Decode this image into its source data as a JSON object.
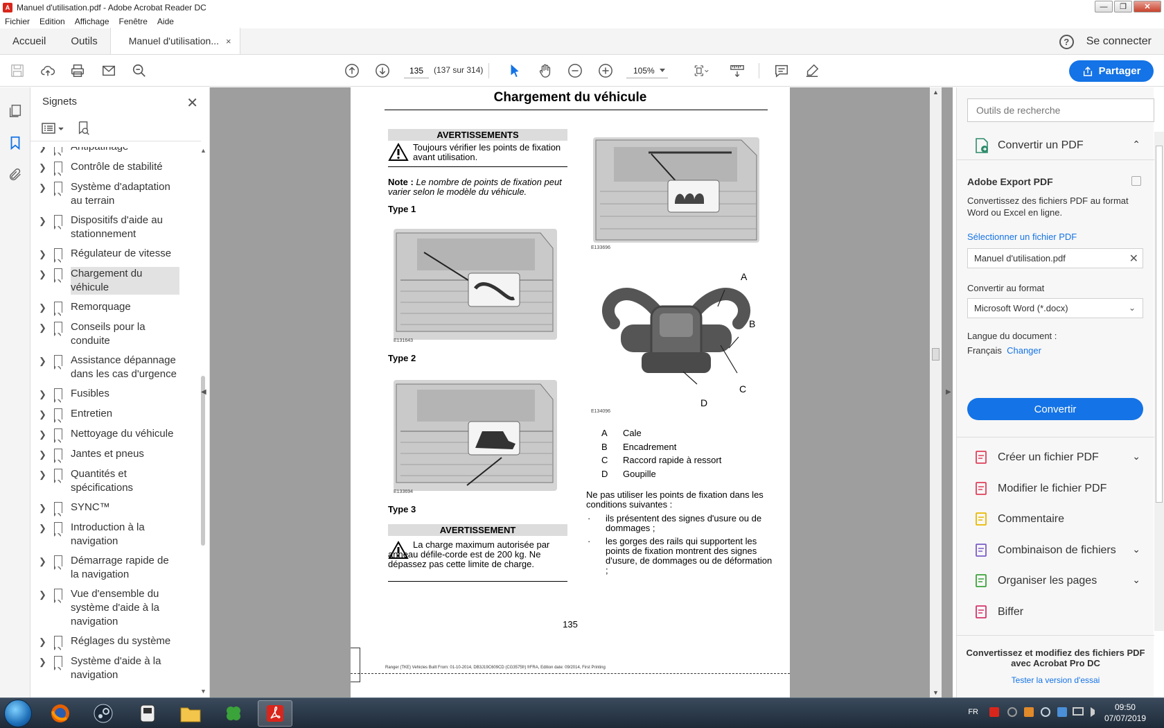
{
  "window": {
    "title": "Manuel d'utilisation.pdf - Adobe Acrobat Reader DC",
    "controls": [
      "—",
      "❐",
      "✕"
    ]
  },
  "menu": [
    "Fichier",
    "Edition",
    "Affichage",
    "Fenêtre",
    "Aide"
  ],
  "tabs": {
    "home": "Accueil",
    "tools": "Outils",
    "document": "Manuel d'utilisation...",
    "close": "×",
    "help": "?",
    "signin": "Se connecter"
  },
  "toolbar": {
    "page_number": "135",
    "page_count": "(137 sur 314)",
    "zoom": "105%",
    "share": "Partager"
  },
  "bookmarks": {
    "title": "Signets",
    "close": "✕",
    "items": [
      {
        "label": "Antipatinage",
        "selected": false
      },
      {
        "label": "Contrôle de stabilité",
        "selected": false
      },
      {
        "label": "Système d'adaptation au terrain",
        "selected": false
      },
      {
        "label": "Dispositifs d'aide au stationnement",
        "selected": false
      },
      {
        "label": "Régulateur de vitesse",
        "selected": false
      },
      {
        "label": "Chargement du véhicule",
        "selected": true
      },
      {
        "label": "Remorquage",
        "selected": false
      },
      {
        "label": "Conseils pour la conduite",
        "selected": false
      },
      {
        "label": "Assistance dépannage dans les cas d'urgence",
        "selected": false
      },
      {
        "label": "Fusibles",
        "selected": false
      },
      {
        "label": "Entretien",
        "selected": false
      },
      {
        "label": "Nettoyage du véhicule",
        "selected": false
      },
      {
        "label": "Jantes et pneus",
        "selected": false
      },
      {
        "label": "Quantités et spécifications",
        "selected": false
      },
      {
        "label": "SYNC™",
        "selected": false
      },
      {
        "label": "Introduction à la navigation",
        "selected": false
      },
      {
        "label": "Démarrage rapide de la navigation",
        "selected": false
      },
      {
        "label": "Vue d'ensemble du système d'aide à la navigation",
        "selected": false
      },
      {
        "label": "Réglages du système",
        "selected": false
      },
      {
        "label": "Système d'aide à la navigation",
        "selected": false
      }
    ]
  },
  "page": {
    "title": "Chargement du véhicule",
    "warnings_header": "AVERTISSEMENTS",
    "warning1": "Toujours vérifier les points de fixation avant utilisation.",
    "note_label": "Note :",
    "note_text": "Le nombre de points de fixation peut varier selon le modèle du véhicule.",
    "type1": "Type 1",
    "type2": "Type 2",
    "type3": "Type 3",
    "img1_code": "E131643",
    "img2_code": "E133694",
    "img3_code": "E133696",
    "img4_code": "E134096",
    "warning_header2": "AVERTISSEMENT",
    "warning2": "La charge maximum autorisée par anneau défile-corde est de 200 kg. Ne dépassez pas cette limite de charge.",
    "callouts": [
      {
        "letter": "A",
        "label": "Cale"
      },
      {
        "letter": "B",
        "label": "Encadrement"
      },
      {
        "letter": "C",
        "label": "Raccord rapide à ressort"
      },
      {
        "letter": "D",
        "label": "Goupille"
      }
    ],
    "diagram_letters": [
      "A",
      "B",
      "C",
      "D"
    ],
    "conditions_intro": "Ne pas utiliser les points de fixation dans les conditions suivantes :",
    "bullets": [
      "ils présentent des signes d'usure ou de dommages ;",
      "les gorges des rails qui supportent les points de fixation montrent des signes d'usure, de dommages ou de déformation ;"
    ],
    "page_num": "135",
    "footer": "Ranger (TKE) Vehicles Built From: 01-10-2014, DB3J19C609CD (CG3575fr) frFRA, Edition date: 09/2014, First Printing"
  },
  "right_panel": {
    "search_placeholder": "Outils de recherche",
    "convert_pdf": "Convertir un PDF",
    "export_title": "Adobe Export PDF",
    "export_desc": "Convertissez des fichiers PDF au format Word ou Excel en ligne.",
    "select_file": "Sélectionner un fichier PDF",
    "file_name": "Manuel d'utilisation.pdf",
    "format_label": "Convertir au format",
    "format_value": "Microsoft Word (*.docx)",
    "lang_label": "Langue du document :",
    "lang_value": "Français",
    "lang_change": "Changer",
    "convert_btn": "Convertir",
    "tools": [
      {
        "label": "Créer un fichier PDF",
        "expandable": true,
        "color": "#e0405a"
      },
      {
        "label": "Modifier le fichier PDF",
        "expandable": false,
        "color": "#e0405a"
      },
      {
        "label": "Commentaire",
        "expandable": false,
        "color": "#e8b800"
      },
      {
        "label": "Combinaison de fichiers",
        "expandable": true,
        "color": "#7b5cc8"
      },
      {
        "label": "Organiser les pages",
        "expandable": true,
        "color": "#3ca33c"
      },
      {
        "label": "Biffer",
        "expandable": false,
        "color": "#d6336c"
      }
    ],
    "promo_text": "Convertissez et modifiez des fichiers PDF avec Acrobat Pro DC",
    "promo_link": "Tester la version d'essai"
  },
  "taskbar": {
    "lang": "FR",
    "time": "09:50",
    "date": "07/07/2019"
  }
}
